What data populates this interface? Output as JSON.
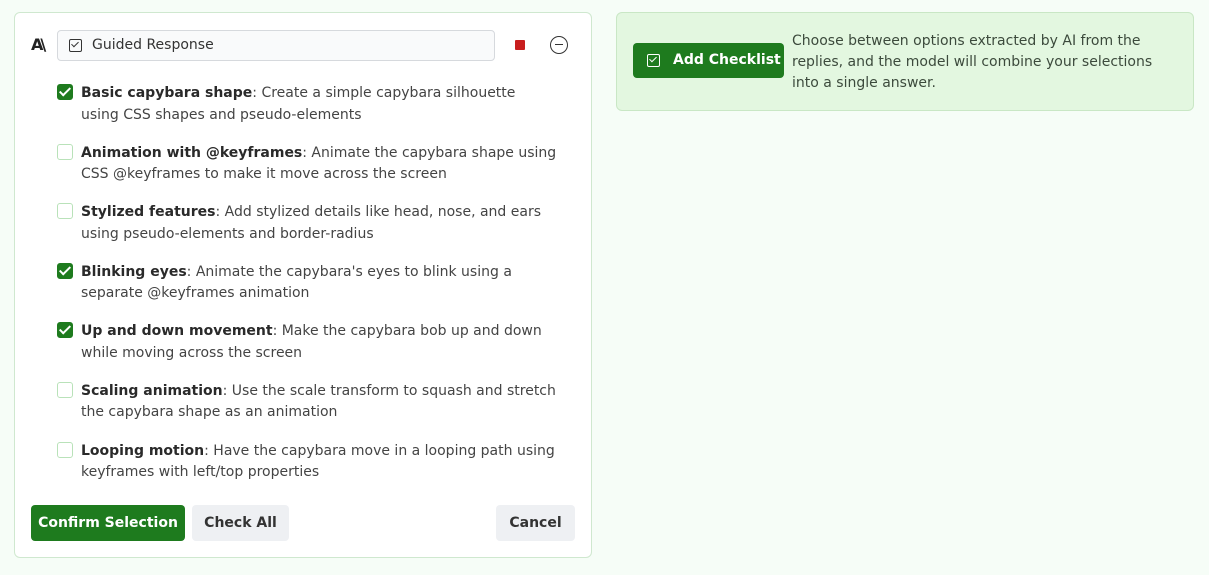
{
  "header": {
    "logo_text": "A\\",
    "title": "Guided Response"
  },
  "items": [
    {
      "checked": true,
      "title": "Basic capybara shape",
      "desc": ": Create a simple capybara silhouette using CSS shapes and pseudo-elements"
    },
    {
      "checked": false,
      "title": "Animation with @keyframes",
      "desc": ": Animate the capybara shape using CSS @keyframes to make it move across the screen"
    },
    {
      "checked": false,
      "title": "Stylized features",
      "desc": ": Add stylized details like head, nose, and ears using pseudo-elements and border-radius"
    },
    {
      "checked": true,
      "title": "Blinking eyes",
      "desc": ": Animate the capybara's eyes to blink using a separate @keyframes animation"
    },
    {
      "checked": true,
      "title": "Up and down movement",
      "desc": ": Make the capybara bob up and down while moving across the screen"
    },
    {
      "checked": false,
      "title": "Scaling animation",
      "desc": ": Use the scale transform to squash and stretch the capybara shape as an animation"
    },
    {
      "checked": false,
      "title": "Looping motion",
      "desc": ": Have the capybara move in a looping path using keyframes with left/top properties"
    }
  ],
  "footer": {
    "confirm_label": "Confirm Selection",
    "check_all_label": "Check All",
    "cancel_label": "Cancel"
  },
  "info": {
    "add_label": "Add Checklist",
    "text": "Choose between options extracted by AI from the replies, and the model will combine your selections into a single answer."
  },
  "colors": {
    "accent": "#1e7b1e",
    "stop": "#c81e1e",
    "info_bg": "#e3f7e0"
  }
}
